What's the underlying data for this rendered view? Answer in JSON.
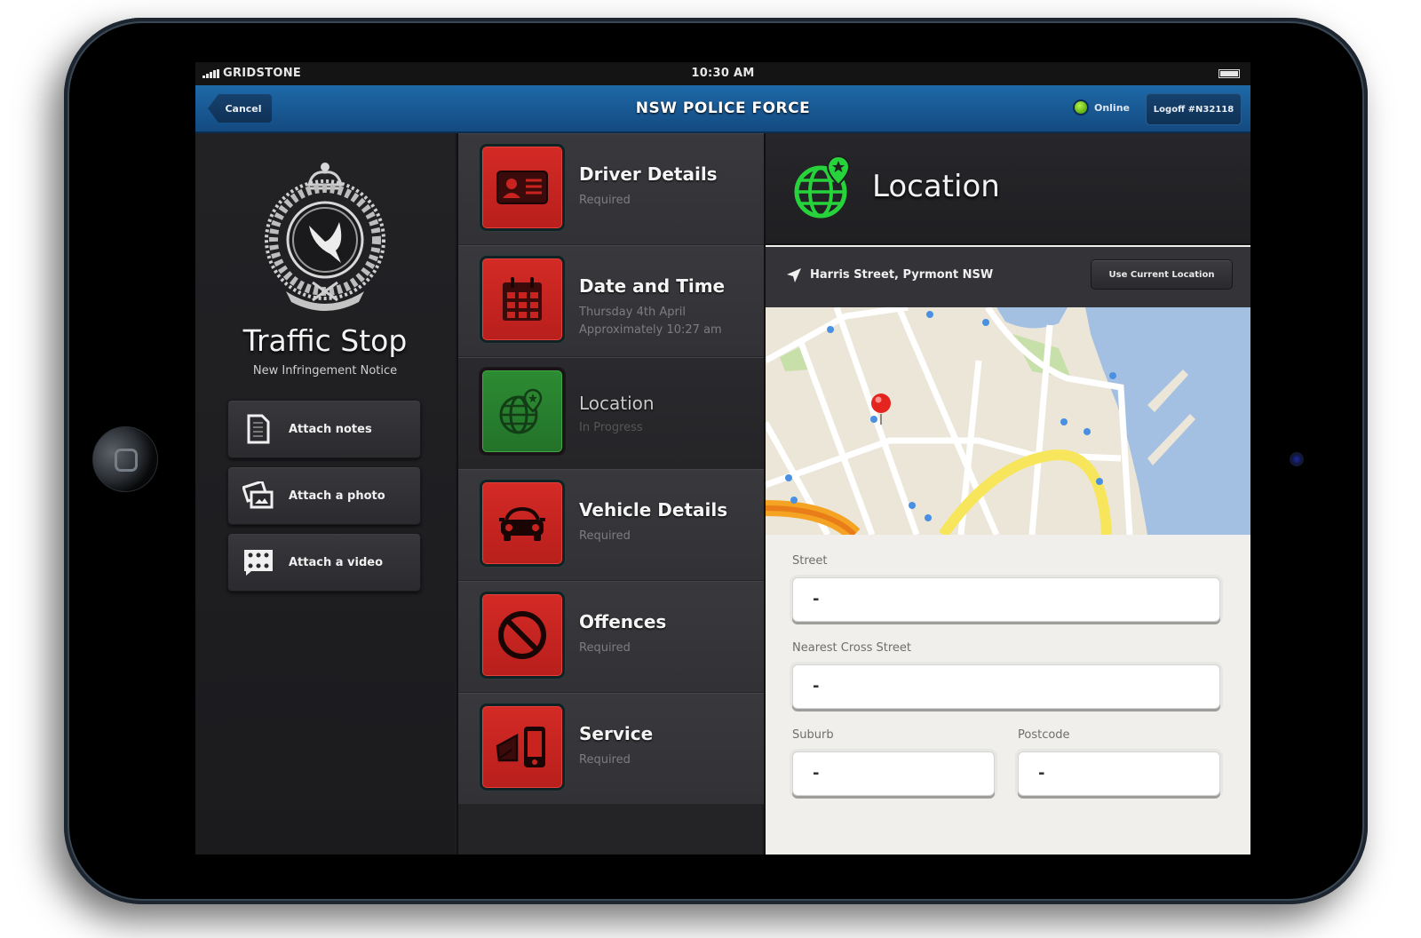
{
  "status_bar": {
    "carrier": "GRIDSTONE",
    "time": "10:30 AM"
  },
  "nav": {
    "cancel_label": "Cancel",
    "title": "NSW POLICE FORCE",
    "online_label": "Online",
    "online_color": "#7ed321",
    "logoff_label": "Logoff #N32118"
  },
  "left_panel": {
    "crest_icon": "nsw-police-crest",
    "title": "Traffic Stop",
    "subtitle": "New Infringement Notice",
    "buttons": [
      {
        "label": "Attach notes",
        "icon": "document-icon"
      },
      {
        "label": "Attach a photo",
        "icon": "photo-icon"
      },
      {
        "label": "Attach a video",
        "icon": "film-icon"
      }
    ]
  },
  "tasks": [
    {
      "title": "Driver Details",
      "sub": "Required",
      "icon": "id-card-icon",
      "status": "required"
    },
    {
      "title": "Date and Time",
      "sub": "Thursday 4th April",
      "sub2": "Approximately 10:27 am",
      "icon": "calendar-icon",
      "status": "required"
    },
    {
      "title": "Location",
      "sub": "In Progress",
      "icon": "globe-pin-icon",
      "status": "in-progress"
    },
    {
      "title": "Vehicle Details",
      "sub": "Required",
      "icon": "car-icon",
      "status": "required"
    },
    {
      "title": "Offences",
      "sub": "Required",
      "icon": "prohibited-icon",
      "status": "required"
    },
    {
      "title": "Service",
      "sub": "Required",
      "icon": "envelope-phone-icon",
      "status": "required"
    }
  ],
  "status_colors": {
    "required": "#c9231f",
    "in_progress": "#2a8430"
  },
  "location_panel": {
    "title": "Location",
    "address": "Harris Street, Pyrmont NSW",
    "use_current_label": "Use Current Location",
    "map": {
      "area": "Pyrmont, Sydney",
      "pin": "red-map-pin"
    },
    "fields": {
      "street": {
        "label": "Street",
        "value": "-"
      },
      "cross_street": {
        "label": "Nearest Cross Street",
        "value": "-"
      },
      "suburb": {
        "label": "Suburb",
        "value": "-"
      },
      "postcode": {
        "label": "Postcode",
        "value": "-"
      }
    }
  }
}
